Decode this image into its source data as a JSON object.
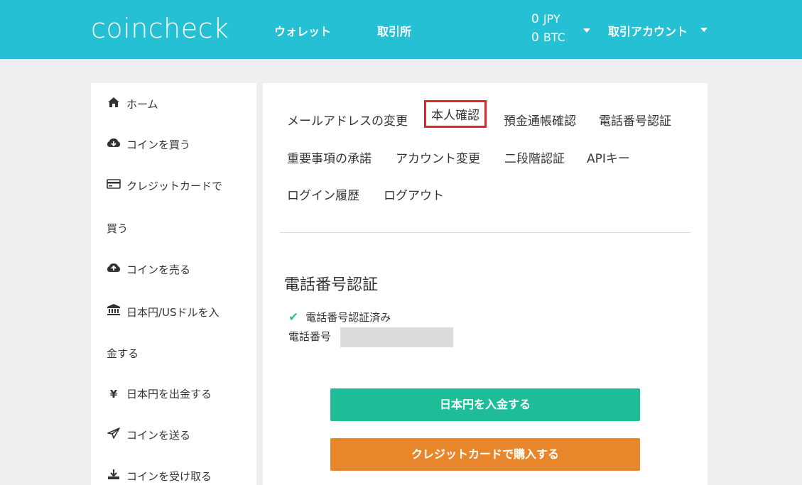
{
  "header": {
    "logo": "coincheck",
    "nav": [
      "ウォレット",
      "取引所"
    ],
    "balance_jpy_value": "0",
    "balance_jpy_unit": "JPY",
    "balance_btc_value": "0",
    "balance_btc_unit": "BTC",
    "account_label": "取引アカウント"
  },
  "sidebar": {
    "items": [
      {
        "icon": "home-icon",
        "glyph": "🏠",
        "label": "ホーム",
        "cont": ""
      },
      {
        "icon": "cloud-download-icon",
        "glyph": "☁",
        "label": "コインを買う",
        "cont": ""
      },
      {
        "icon": "credit-card-icon",
        "glyph": "▭",
        "label": "クレジットカードで",
        "cont": "買う"
      },
      {
        "icon": "cloud-upload-icon",
        "glyph": "☁",
        "label": "コインを売る",
        "cont": ""
      },
      {
        "icon": "bank-icon",
        "glyph": "🏛",
        "label": "日本円/USドルを入",
        "cont": "金する"
      },
      {
        "icon": "yen-icon",
        "glyph": "¥",
        "label": "日本円を出金する",
        "cont": ""
      },
      {
        "icon": "send-icon",
        "glyph": "✈",
        "label": "コインを送る",
        "cont": ""
      },
      {
        "icon": "download-icon",
        "glyph": "⬇",
        "label": "コインを受け取る",
        "cont": ""
      }
    ]
  },
  "tabs": [
    "メールアドレスの変更",
    "本人確認",
    "預金通帳確認",
    "電話番号認証",
    "重要事項の承諾",
    "アカウント変更",
    "二段階認証",
    "APIキー",
    "ログイン履歴",
    "ログアウト"
  ],
  "section": {
    "title": "電話番号認証",
    "verified_text": "電話番号認証済み",
    "phone_label": "電話番号"
  },
  "buttons": {
    "deposit": "日本円を入金する",
    "card_buy": "クレジットカードで購入する"
  }
}
